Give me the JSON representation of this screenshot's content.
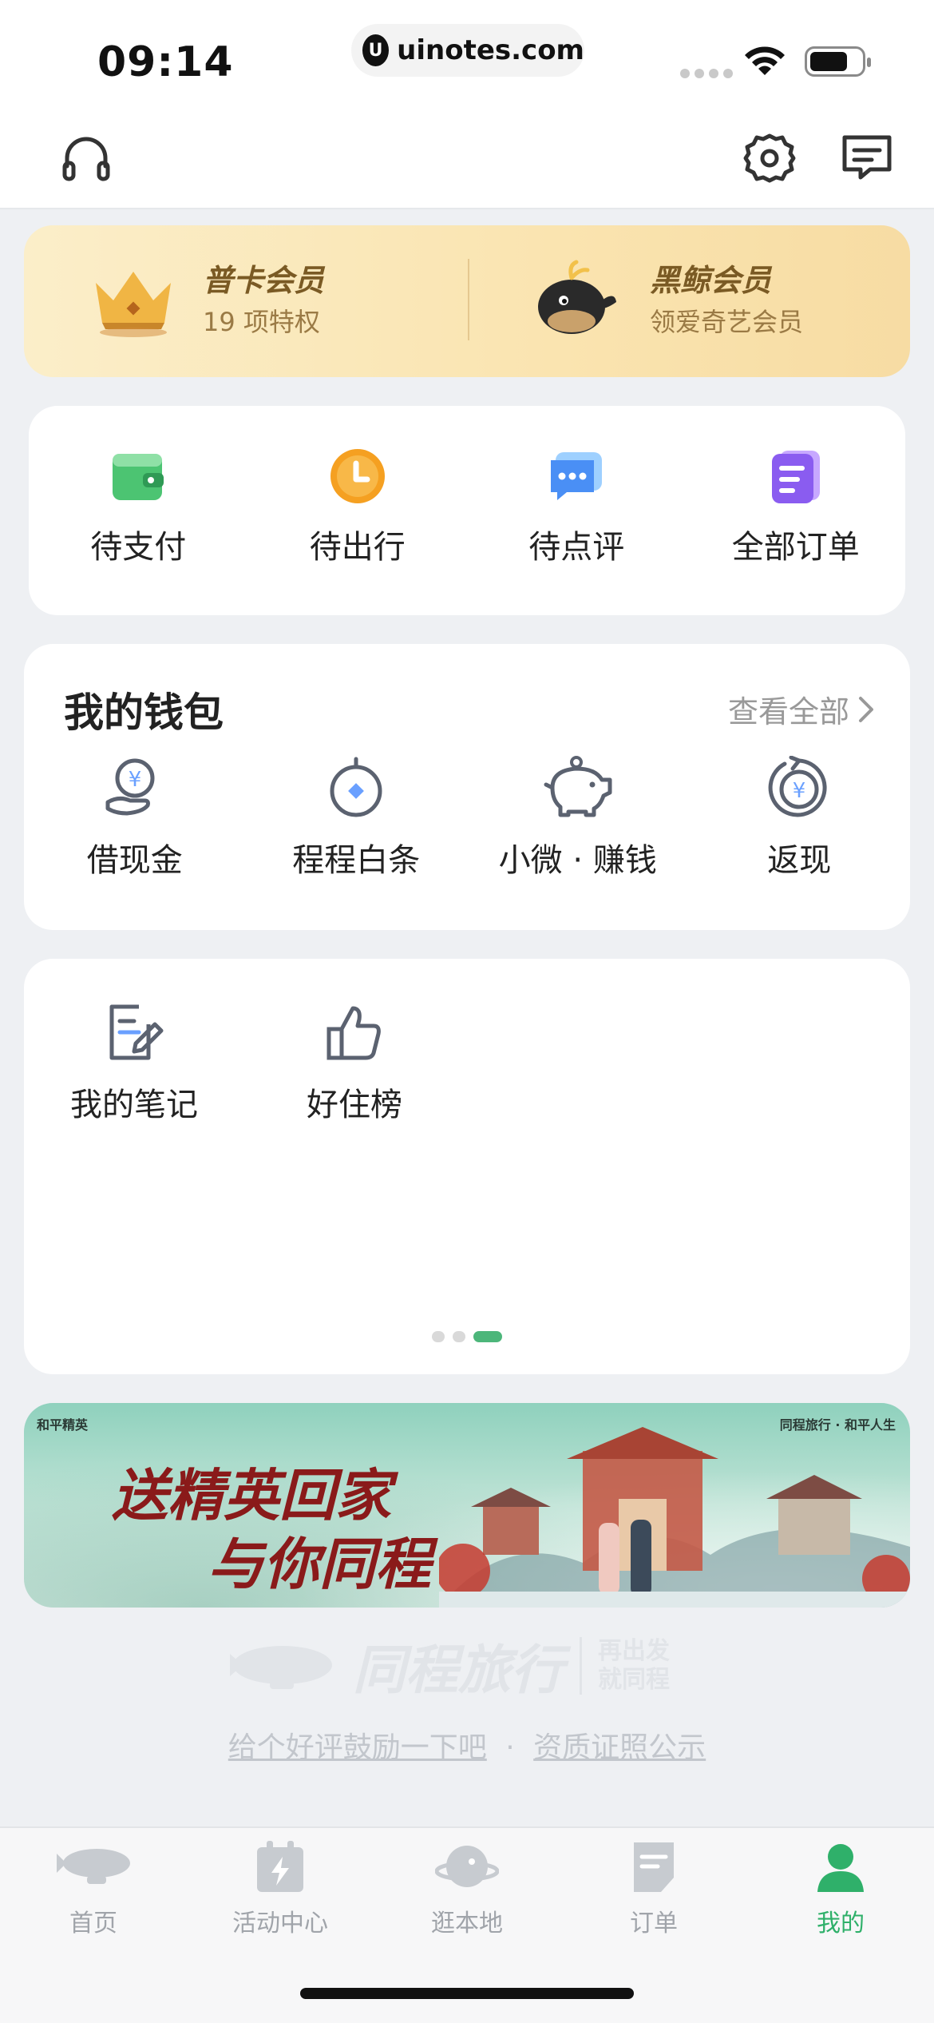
{
  "status_bar": {
    "time": "09:14",
    "url": "uinotes.com"
  },
  "header": {
    "left_icon": "headphones-icon",
    "right_icons": [
      "gear-icon",
      "message-icon"
    ]
  },
  "membership": {
    "items": [
      {
        "title": "普卡会员",
        "subtitle": "19 项特权",
        "icon": "crown-icon"
      },
      {
        "title": "黑鲸会员",
        "subtitle": "领爱奇艺会员",
        "icon": "whale-icon"
      }
    ]
  },
  "orders": {
    "items": [
      {
        "label": "待支付",
        "icon": "wallet-icon",
        "color": "#4cc472"
      },
      {
        "label": "待出行",
        "icon": "clock-icon",
        "color": "#f5a021"
      },
      {
        "label": "待点评",
        "icon": "chat-bubble-icon",
        "color": "#4a8ff5"
      },
      {
        "label": "全部订单",
        "icon": "list-icon",
        "color": "#8a5cf0"
      }
    ]
  },
  "wallet": {
    "title": "我的钱包",
    "view_all": "查看全部",
    "items": [
      {
        "label": "借现金",
        "icon": "hand-coin-icon"
      },
      {
        "label": "程程白条",
        "icon": "coin-circle-icon"
      },
      {
        "label": "小微 · 赚钱",
        "icon": "piggy-bank-icon"
      },
      {
        "label": "返现",
        "icon": "cashback-icon"
      }
    ]
  },
  "tools": {
    "items": [
      {
        "label": "我的笔记",
        "icon": "note-edit-icon"
      },
      {
        "label": "好住榜",
        "icon": "thumbs-up-icon"
      }
    ],
    "pager": {
      "count": 3,
      "active": 2
    }
  },
  "promo": {
    "headline_1": "送精英回家",
    "headline_2": "与你同程",
    "brand_left": "和平精英",
    "brand_right": "同程旅行 · 和平人生"
  },
  "footer": {
    "brand": "同程旅行",
    "slogan_1": "再出发",
    "slogan_2": "就同程",
    "link_1": "给个好评鼓励一下吧",
    "separator": "·",
    "link_2": "资质证照公示"
  },
  "tabbar": {
    "items": [
      {
        "label": "首页",
        "icon": "airship-icon"
      },
      {
        "label": "活动中心",
        "icon": "calendar-bolt-icon"
      },
      {
        "label": "逛本地",
        "icon": "planet-icon"
      },
      {
        "label": "订单",
        "icon": "document-icon"
      },
      {
        "label": "我的",
        "icon": "person-icon"
      }
    ],
    "active_index": 4,
    "active_color": "#2fb06a"
  }
}
